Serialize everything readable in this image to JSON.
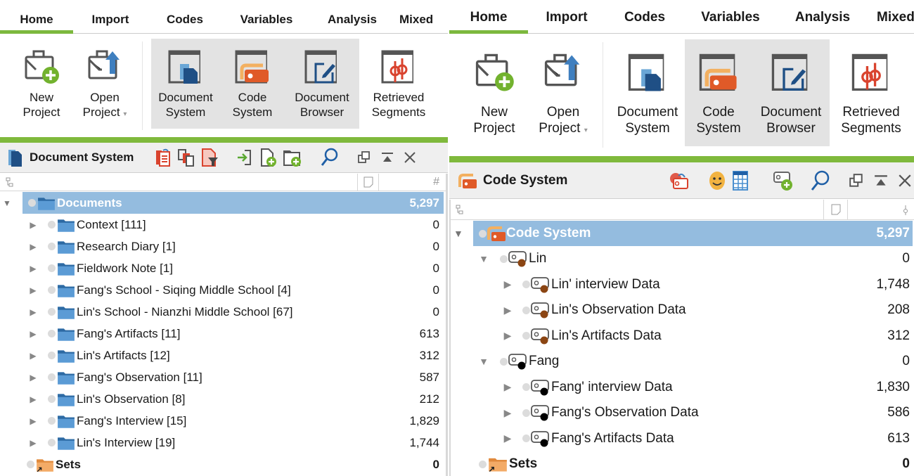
{
  "left": {
    "tabs": [
      {
        "label": "Home",
        "active": true
      },
      {
        "label": "Import"
      },
      {
        "label": "Codes"
      },
      {
        "label": "Variables"
      },
      {
        "label": "Analysis"
      },
      {
        "label": "Mixed"
      }
    ],
    "ribbon": {
      "new_project": {
        "line1": "New",
        "line2": "Project"
      },
      "open_project": {
        "line1": "Open",
        "line2": "Project"
      },
      "document_system": {
        "line1": "Document",
        "line2": "System"
      },
      "code_system": {
        "line1": "Code",
        "line2": "System"
      },
      "document_browser": {
        "line1": "Document",
        "line2": "Browser"
      },
      "retrieved_segments": {
        "line1": "Retrieved",
        "line2": "Segments"
      }
    },
    "window": {
      "title": "Document System",
      "col_count_symbol": "#"
    },
    "tree": {
      "root": {
        "label": "Documents",
        "value": "5,297"
      },
      "items": [
        {
          "label": "Context [111]",
          "value": "0"
        },
        {
          "label": "Research Diary [1]",
          "value": "0"
        },
        {
          "label": "Fieldwork Note [1]",
          "value": "0"
        },
        {
          "label": "Fang's School - Siqing Middle School [4]",
          "value": "0"
        },
        {
          "label": "Lin's School - Nianzhi Middle School [67]",
          "value": "0"
        },
        {
          "label": "Fang's Artifacts [11]",
          "value": "613"
        },
        {
          "label": "Lin's Artifacts [12]",
          "value": "312"
        },
        {
          "label": "Fang's Observation [11]",
          "value": "587"
        },
        {
          "label": "Lin's Observation [8]",
          "value": "212"
        },
        {
          "label": "Fang's Interview [15]",
          "value": "1,829"
        },
        {
          "label": "Lin's Interview [19]",
          "value": "1,744"
        }
      ],
      "sets": {
        "label": "Sets",
        "value": "0"
      }
    }
  },
  "right": {
    "tabs": [
      {
        "label": "Home",
        "active": true
      },
      {
        "label": "Import"
      },
      {
        "label": "Codes"
      },
      {
        "label": "Variables"
      },
      {
        "label": "Analysis"
      },
      {
        "label": "Mixed"
      }
    ],
    "ribbon": {
      "new_project": {
        "line1": "New",
        "line2": "Project"
      },
      "open_project": {
        "line1": "Open",
        "line2": "Project"
      },
      "document_system": {
        "line1": "Document",
        "line2": "System"
      },
      "code_system": {
        "line1": "Code",
        "line2": "System"
      },
      "document_browser": {
        "line1": "Document",
        "line2": "Browser"
      },
      "retrieved_segments": {
        "line1": "Retrieved",
        "line2": "Segments"
      }
    },
    "window": {
      "title": "Code System"
    },
    "tree": {
      "root": {
        "label": "Code System",
        "value": "5,297"
      },
      "groups": [
        {
          "label": "Lin",
          "value": "0",
          "color": "#8b4513",
          "children": [
            {
              "label": "Lin' interview Data",
              "value": "1,748"
            },
            {
              "label": "Lin's Observation Data",
              "value": "208"
            },
            {
              "label": "Lin's Artifacts Data",
              "value": "312"
            }
          ]
        },
        {
          "label": "Fang",
          "value": "0",
          "color": "#000000",
          "children": [
            {
              "label": "Fang' interview Data",
              "value": "1,830"
            },
            {
              "label": "Fang's Observation Data",
              "value": "586"
            },
            {
              "label": "Fang's Artifacts Data",
              "value": "613"
            }
          ]
        }
      ],
      "sets": {
        "label": "Sets",
        "value": "0"
      }
    }
  },
  "colors": {
    "accent_green": "#7cb83e",
    "selection_blue": "#94bcdf",
    "folder_blue": "#5b9bd5",
    "code_orange": "#e05a28",
    "sets_orange": "#f0a860"
  }
}
